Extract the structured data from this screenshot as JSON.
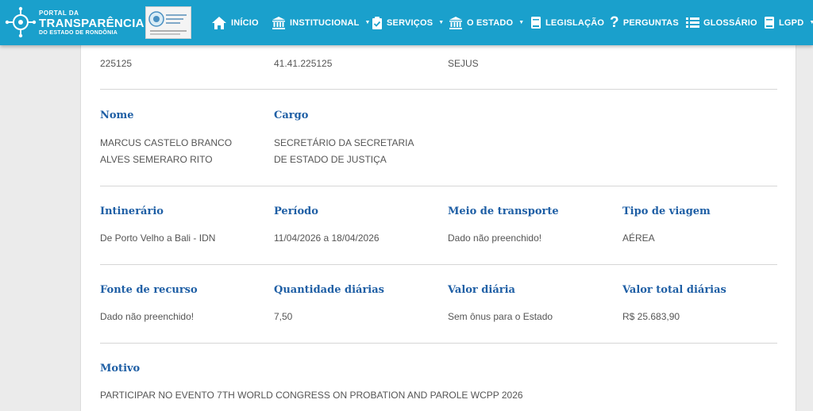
{
  "header": {
    "logo": {
      "line1": "PORTAL DA",
      "line2": "TRANSPARÊNCIA",
      "line3": "DO ESTADO DE RONDÔNIA"
    },
    "nav": [
      {
        "label": "INÍCIO",
        "icon": "home-icon"
      },
      {
        "label": "INSTITUCIONAL",
        "icon": "institution-icon",
        "dropdown": true
      },
      {
        "label": "SERVIÇOS",
        "icon": "clipboard-check-icon",
        "dropdown": true
      },
      {
        "label": "O ESTADO",
        "icon": "institution-icon",
        "dropdown": true
      },
      {
        "label": "LEGISLAÇÃO",
        "icon": "book-icon"
      },
      {
        "label": "PERGUNTAS",
        "icon": "question-icon"
      },
      {
        "label": "GLOSSÁRIO",
        "icon": "list-icon"
      },
      {
        "label": "LGPD",
        "icon": "book-icon",
        "dropdown": true
      }
    ]
  },
  "details": {
    "top_row": [
      "225125",
      "41.41.225125",
      "SEJUS"
    ],
    "nome": {
      "label": "Nome",
      "value": "MARCUS CASTELO BRANCO ALVES SEMERARO RITO"
    },
    "cargo": {
      "label": "Cargo",
      "value": "SECRETÁRIO DA SECRETARIA DE ESTADO DE JUSTIÇA"
    },
    "itinerario": {
      "label": "Intinerário",
      "value": "De Porto Velho a Bali - IDN"
    },
    "periodo": {
      "label": "Período",
      "value": "11/04/2026 a 18/04/2026"
    },
    "meio_transporte": {
      "label": "Meio de transporte",
      "value": "Dado não preenchido!"
    },
    "tipo_viagem": {
      "label": "Tipo de viagem",
      "value": "AÉREA"
    },
    "fonte_recurso": {
      "label": "Fonte de recurso",
      "value": "Dado não preenchido!"
    },
    "quantidade_diarias": {
      "label": "Quantidade diárias",
      "value": "7,50"
    },
    "valor_diaria": {
      "label": "Valor diária",
      "value": "Sem ônus para o Estado"
    },
    "valor_total_diarias": {
      "label": "Valor total diárias",
      "value": "R$ 25.683,90"
    },
    "motivo": {
      "label": "Motivo",
      "value": "PARTICIPAR NO EVENTO 7TH WORLD CONGRESS ON PROBATION AND PAROLE WCPP 2026"
    }
  },
  "colors": {
    "header_bg": "#1aa0cc",
    "label": "#1f5fa5",
    "text": "#555555",
    "page_bg": "#ebebeb"
  }
}
